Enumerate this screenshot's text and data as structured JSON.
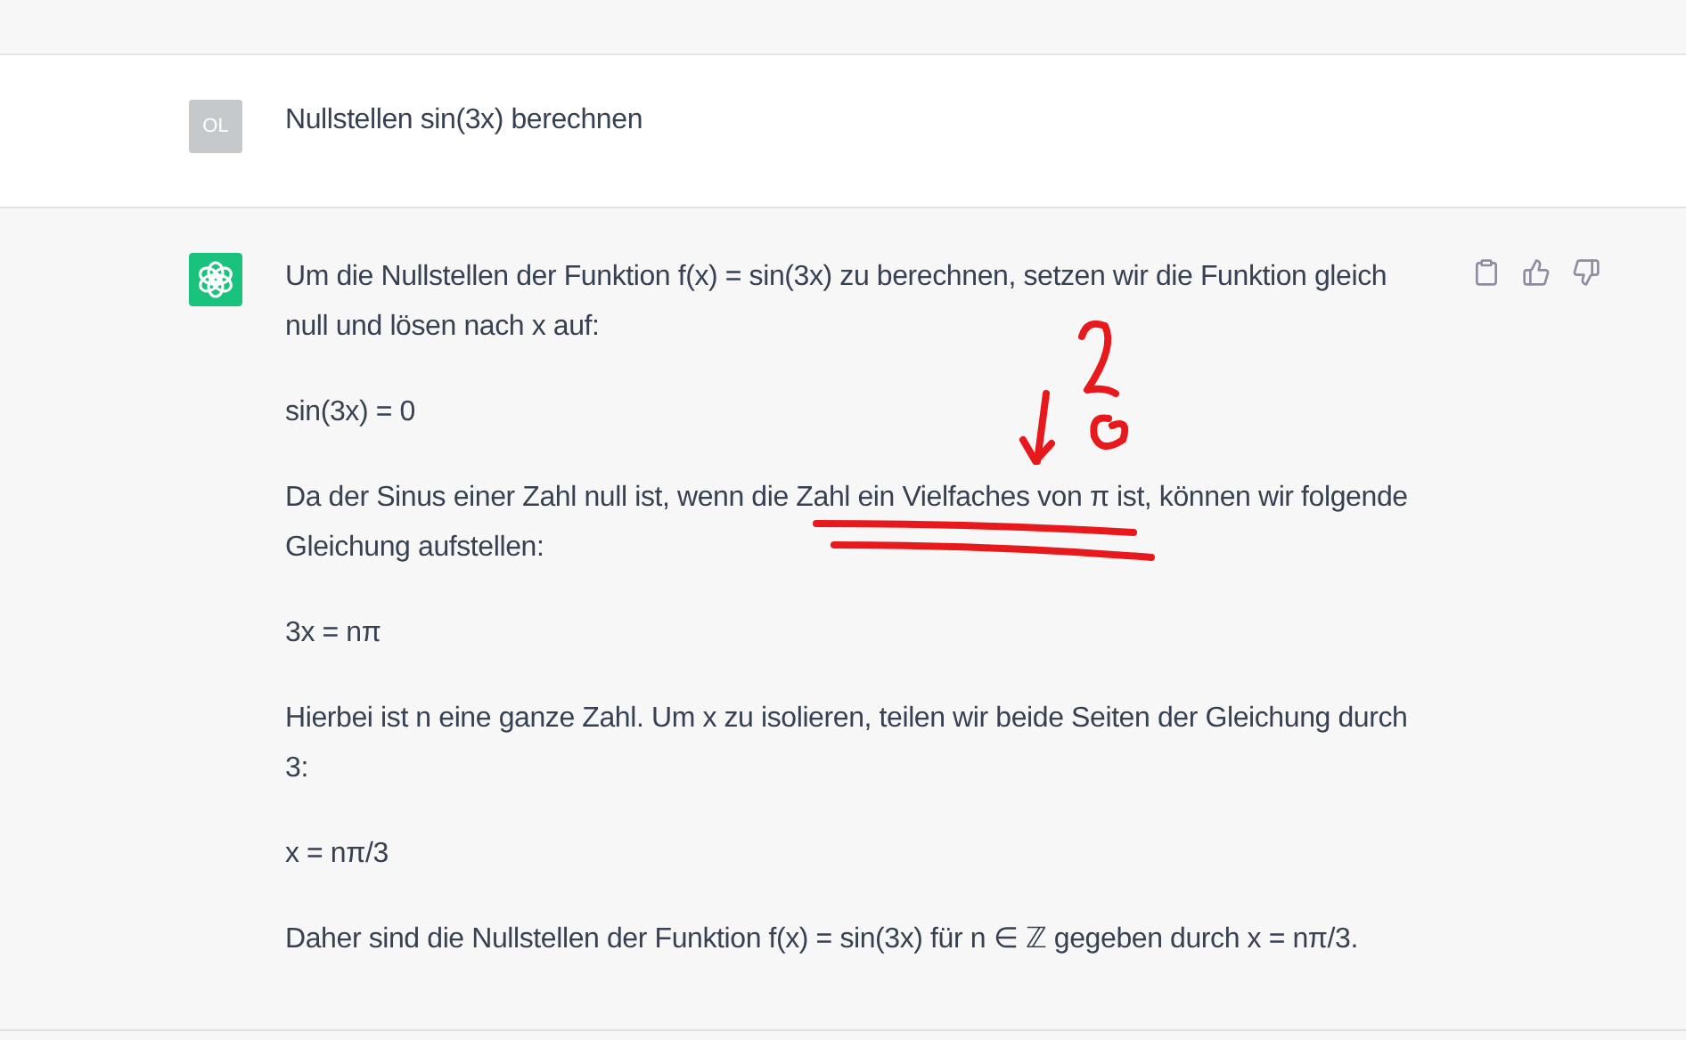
{
  "messages": [
    {
      "kind": "user",
      "avatar": "OL",
      "paragraphs": [
        "Nullstellen sin(3x) berechnen"
      ]
    },
    {
      "kind": "assistant",
      "paragraphs": [
        "Um die Nullstellen der Funktion f(x) = sin(3x) zu berechnen, setzen wir die Funktion gleich null und lösen nach x auf:",
        "sin(3x) = 0",
        "Da der Sinus einer Zahl null ist, wenn die Zahl ein Vielfaches von π ist, können wir folgende Gleichung aufstellen:",
        "3x = nπ",
        "Hierbei ist n eine ganze Zahl. Um x zu isolieren, teilen wir beide Seiten der Gleichung durch 3:",
        "x = nπ/3",
        "Daher sind die Nullstellen der Funktion f(x) = sin(3x) für n ∈ ℤ gegeben durch x = nπ/3."
      ]
    }
  ]
}
